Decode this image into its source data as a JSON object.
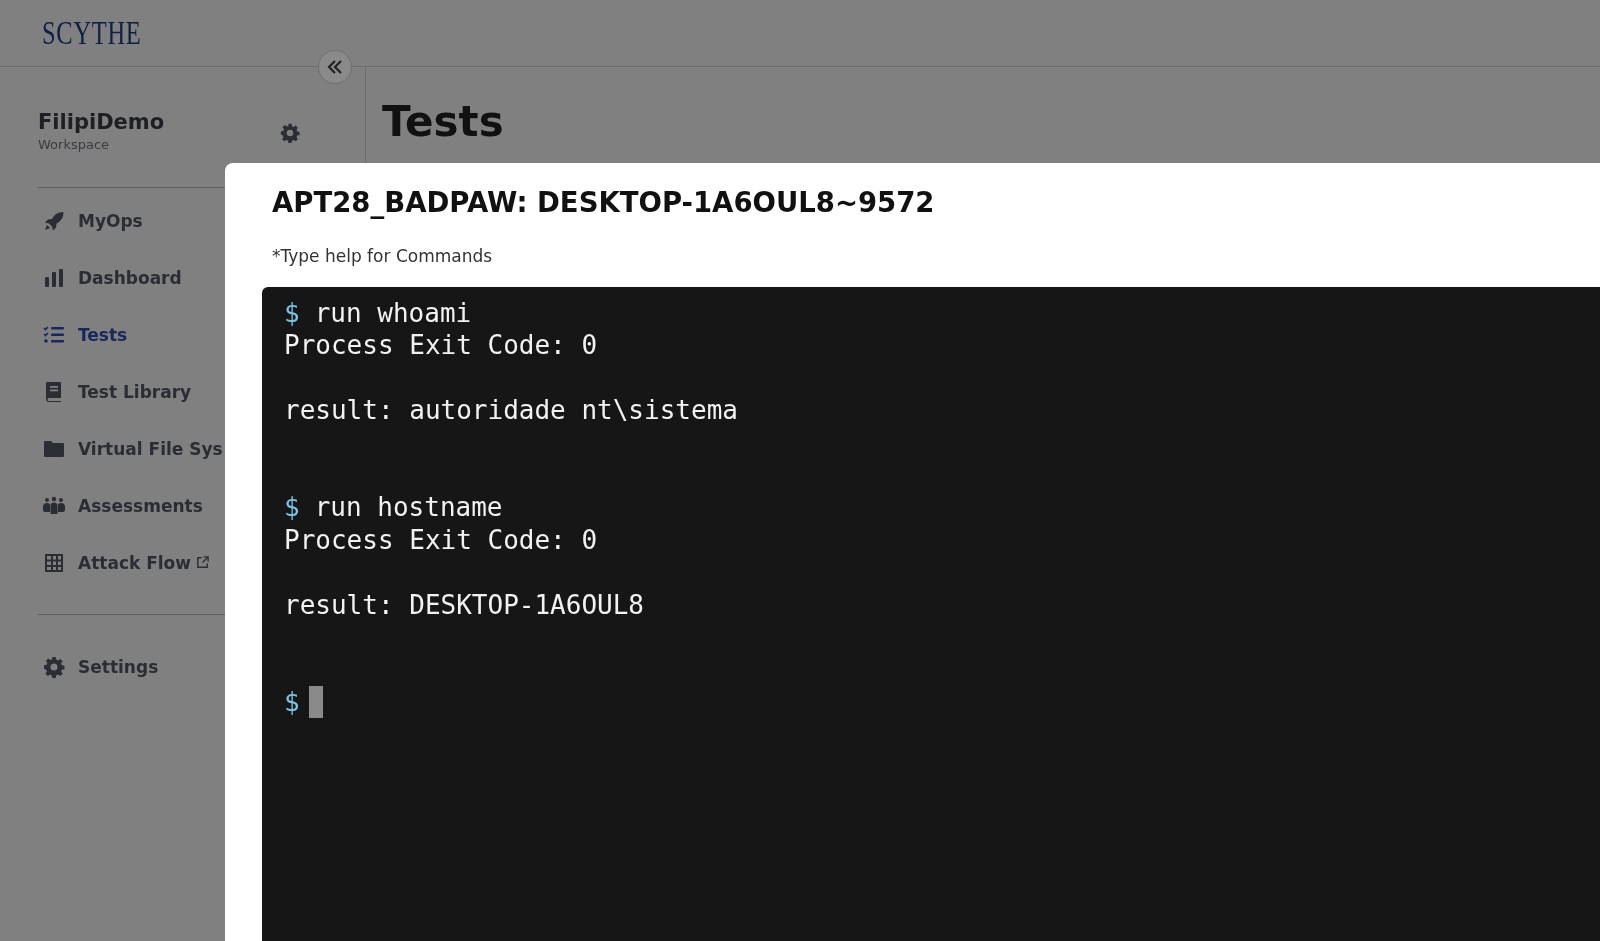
{
  "logo": {
    "text": "SCYTHE"
  },
  "workspace": {
    "name": "FilipiDemo",
    "label": "Workspace"
  },
  "sidebar": {
    "items": [
      {
        "label": "MyOps",
        "selected": false
      },
      {
        "label": "Dashboard",
        "selected": false
      },
      {
        "label": "Tests",
        "selected": true
      },
      {
        "label": "Test Library",
        "selected": false
      },
      {
        "label": "Virtual File Sys",
        "selected": false
      },
      {
        "label": "Assessments",
        "selected": false
      },
      {
        "label": "Attack Flow",
        "selected": false,
        "external": true
      }
    ],
    "bottom_items": [
      {
        "label": "Settings",
        "selected": false
      }
    ]
  },
  "page": {
    "title": "Tests"
  },
  "modal": {
    "title": "APT28_BADPAW: DESKTOP-1A6OUL8~9572",
    "hint": "*Type help for Commands",
    "terminal": {
      "lines": [
        {
          "kind": "command",
          "prompt": "$",
          "text": "run whoami"
        },
        {
          "kind": "output",
          "text": "Process Exit Code: 0"
        },
        {
          "kind": "blank"
        },
        {
          "kind": "output",
          "text": "result: autoridade nt\\sistema"
        },
        {
          "kind": "blank"
        },
        {
          "kind": "blank"
        },
        {
          "kind": "command",
          "prompt": "$",
          "text": "run hostname"
        },
        {
          "kind": "output",
          "text": "Process Exit Code: 0"
        },
        {
          "kind": "blank"
        },
        {
          "kind": "output",
          "text": "result: DESKTOP-1A6OUL8"
        },
        {
          "kind": "blank"
        },
        {
          "kind": "blank"
        },
        {
          "kind": "input",
          "prompt": "$"
        }
      ]
    }
  }
}
